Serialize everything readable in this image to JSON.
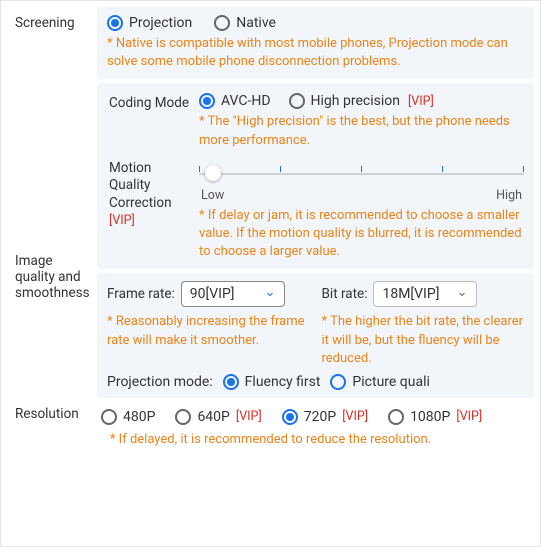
{
  "screening": {
    "label": "Screening",
    "options": {
      "projection": "Projection",
      "native": "Native"
    },
    "selected": "projection",
    "hint": "* Native is compatible with most mobile phones, Projection mode can solve some mobile phone disconnection problems."
  },
  "imageQuality": {
    "label": "Image quality and smoothness",
    "codingMode": {
      "label": "Coding Mode",
      "options": {
        "avchd": "AVC-HD",
        "highprec": "High precision"
      },
      "selected": "avchd",
      "vip": "[VIP]",
      "hint": "* The \"High precision\" is the best, but the phone needs more performance."
    },
    "motion": {
      "label": "Motion Quality Correction",
      "vip": "[VIP]",
      "low": "Low",
      "high": "High",
      "hint": "* If delay or jam, it is recommended to choose a smaller value. If the motion quality is blurred, it is recommended to choose a larger value."
    },
    "frameRate": {
      "label": "Frame rate:",
      "value": "90[VIP]",
      "hint": "* Reasonably increasing the frame rate will make it smoother."
    },
    "bitRate": {
      "label": "Bit rate:",
      "value": "18M[VIP]",
      "hint": "* The higher the bit rate, the clearer it will be, but the fluency will be reduced."
    },
    "projectionMode": {
      "label": "Projection mode:",
      "options": {
        "fluency": "Fluency first",
        "picture": "Picture quali"
      },
      "selected": "fluency"
    }
  },
  "resolution": {
    "label": "Resolution",
    "options": [
      {
        "key": "480p",
        "label": "480P",
        "vip": false
      },
      {
        "key": "640p",
        "label": "640P",
        "vip": true
      },
      {
        "key": "720p",
        "label": "720P",
        "vip": true
      },
      {
        "key": "1080p",
        "label": "1080P",
        "vip": true
      }
    ],
    "vipText": "[VIP]",
    "selected": "720p",
    "hint": "* If delayed, it is recommended to reduce the resolution."
  }
}
